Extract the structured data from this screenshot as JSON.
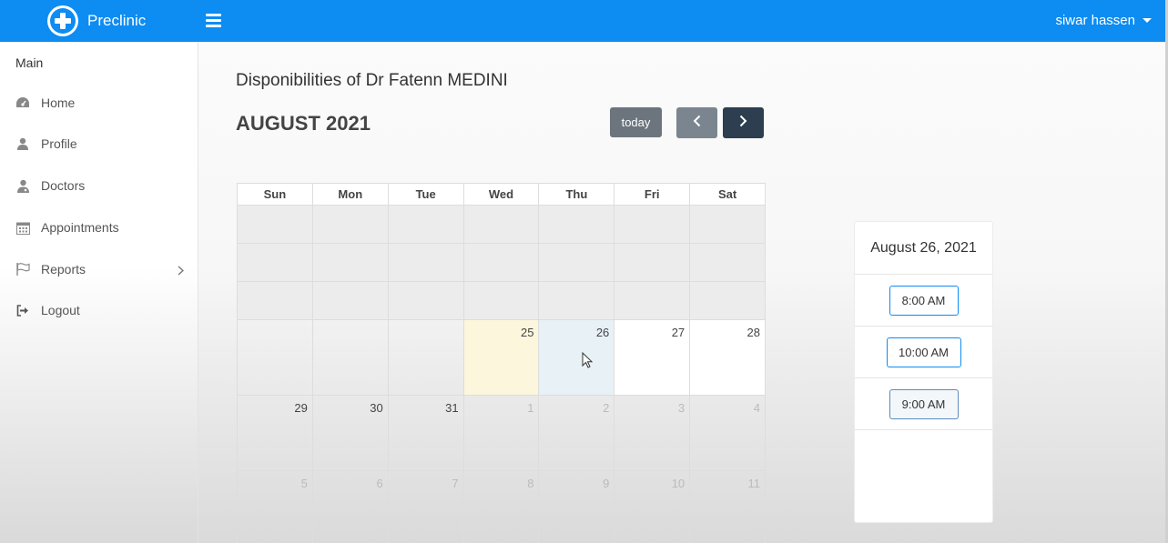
{
  "header": {
    "brand": "Preclinic",
    "user_name": "siwar hassen"
  },
  "sidebar": {
    "title": "Main",
    "items": [
      {
        "label": "Home",
        "icon": "dashboard-icon"
      },
      {
        "label": "Profile",
        "icon": "user-icon"
      },
      {
        "label": "Doctors",
        "icon": "doctor-icon"
      },
      {
        "label": "Appointments",
        "icon": "calendar-icon"
      },
      {
        "label": "Reports",
        "icon": "flag-icon",
        "has_submenu": true
      },
      {
        "label": "Logout",
        "icon": "logout-icon"
      }
    ]
  },
  "main": {
    "title": "Disponibilities of Dr Fatenn MEDINI",
    "month": "AUGUST 2021",
    "today_label": "today",
    "weekdays": [
      "Sun",
      "Mon",
      "Tue",
      "Wed",
      "Thu",
      "Fri",
      "Sat"
    ],
    "week1": [
      "",
      "",
      "",
      "25",
      "26",
      "27",
      "28"
    ],
    "week2": [
      "29",
      "30",
      "31",
      "1",
      "2",
      "3",
      "4"
    ],
    "week3": [
      "5",
      "6",
      "7",
      "8",
      "9",
      "10",
      "11"
    ]
  },
  "availability": {
    "date": "August 26, 2021",
    "slots": [
      "8:00 AM",
      "10:00 AM",
      "9:00 AM"
    ]
  },
  "colors": {
    "header_bg": "#0d8cf2",
    "today_cell": "#fcf6dc",
    "selected_cell": "#e7f1f6",
    "next_button": "#2c3e50"
  }
}
